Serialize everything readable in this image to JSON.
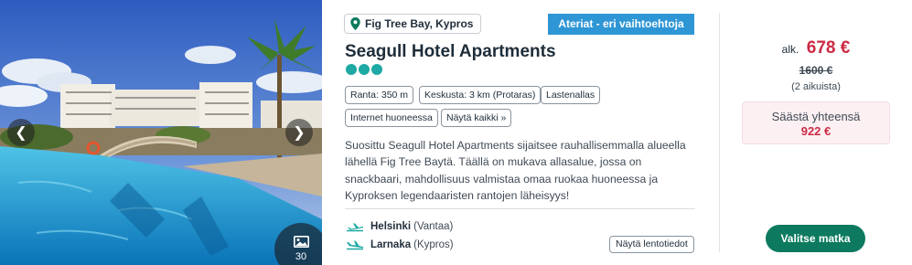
{
  "photo": {
    "prev_icon": "chevron-left-icon",
    "next_icon": "chevron-right-icon",
    "gallery_icon": "image-gallery-icon",
    "gallery_count": "30"
  },
  "location": {
    "icon": "map-pin-icon",
    "label": "Fig Tree Bay, Kypros"
  },
  "meal_tag": "Ateriat - eri vaihtoehtoja",
  "hotel": {
    "name": "Seagull Hotel Apartments",
    "rating_icons": 3,
    "rating_color": "#1fa9a4"
  },
  "chips": [
    "Ranta: 350 m",
    "Keskusta: 3 km (Protaras)",
    "Lastenallas",
    "Internet huoneessa",
    "Näytä kaikki »"
  ],
  "description": "Suosittu Seagull Hotel Apartments sijaitsee rauhallisemmalla alueella lähellä Fig Tree Baytä. Täällä on mukava allasalue, jossa on snackbaari, mahdollisuus valmistaa omaa ruokaa huoneessa ja Kyproksen legendaaristen rantojen läheisyys!",
  "flights": {
    "outbound": {
      "city": "Helsinki",
      "region": "(Vantaa)",
      "icon": "plane-departure-icon"
    },
    "inbound": {
      "city": "Larnaka",
      "region": "(Kypros)",
      "icon": "plane-arrival-icon"
    },
    "details_button": "Näytä lentotiedot"
  },
  "price": {
    "prefix": "alk.",
    "current": "678 €",
    "original": "1600 €",
    "pax": "(2 aikuista)",
    "save_label": "Säästä yhteensä",
    "save_amount": "922 €"
  },
  "cta": "Valitse matka",
  "colors": {
    "accent_blue": "#2f96d6",
    "price_red": "#cc2b44",
    "cta_green": "#0d7a5f",
    "save_bg": "#fdf0f2"
  }
}
